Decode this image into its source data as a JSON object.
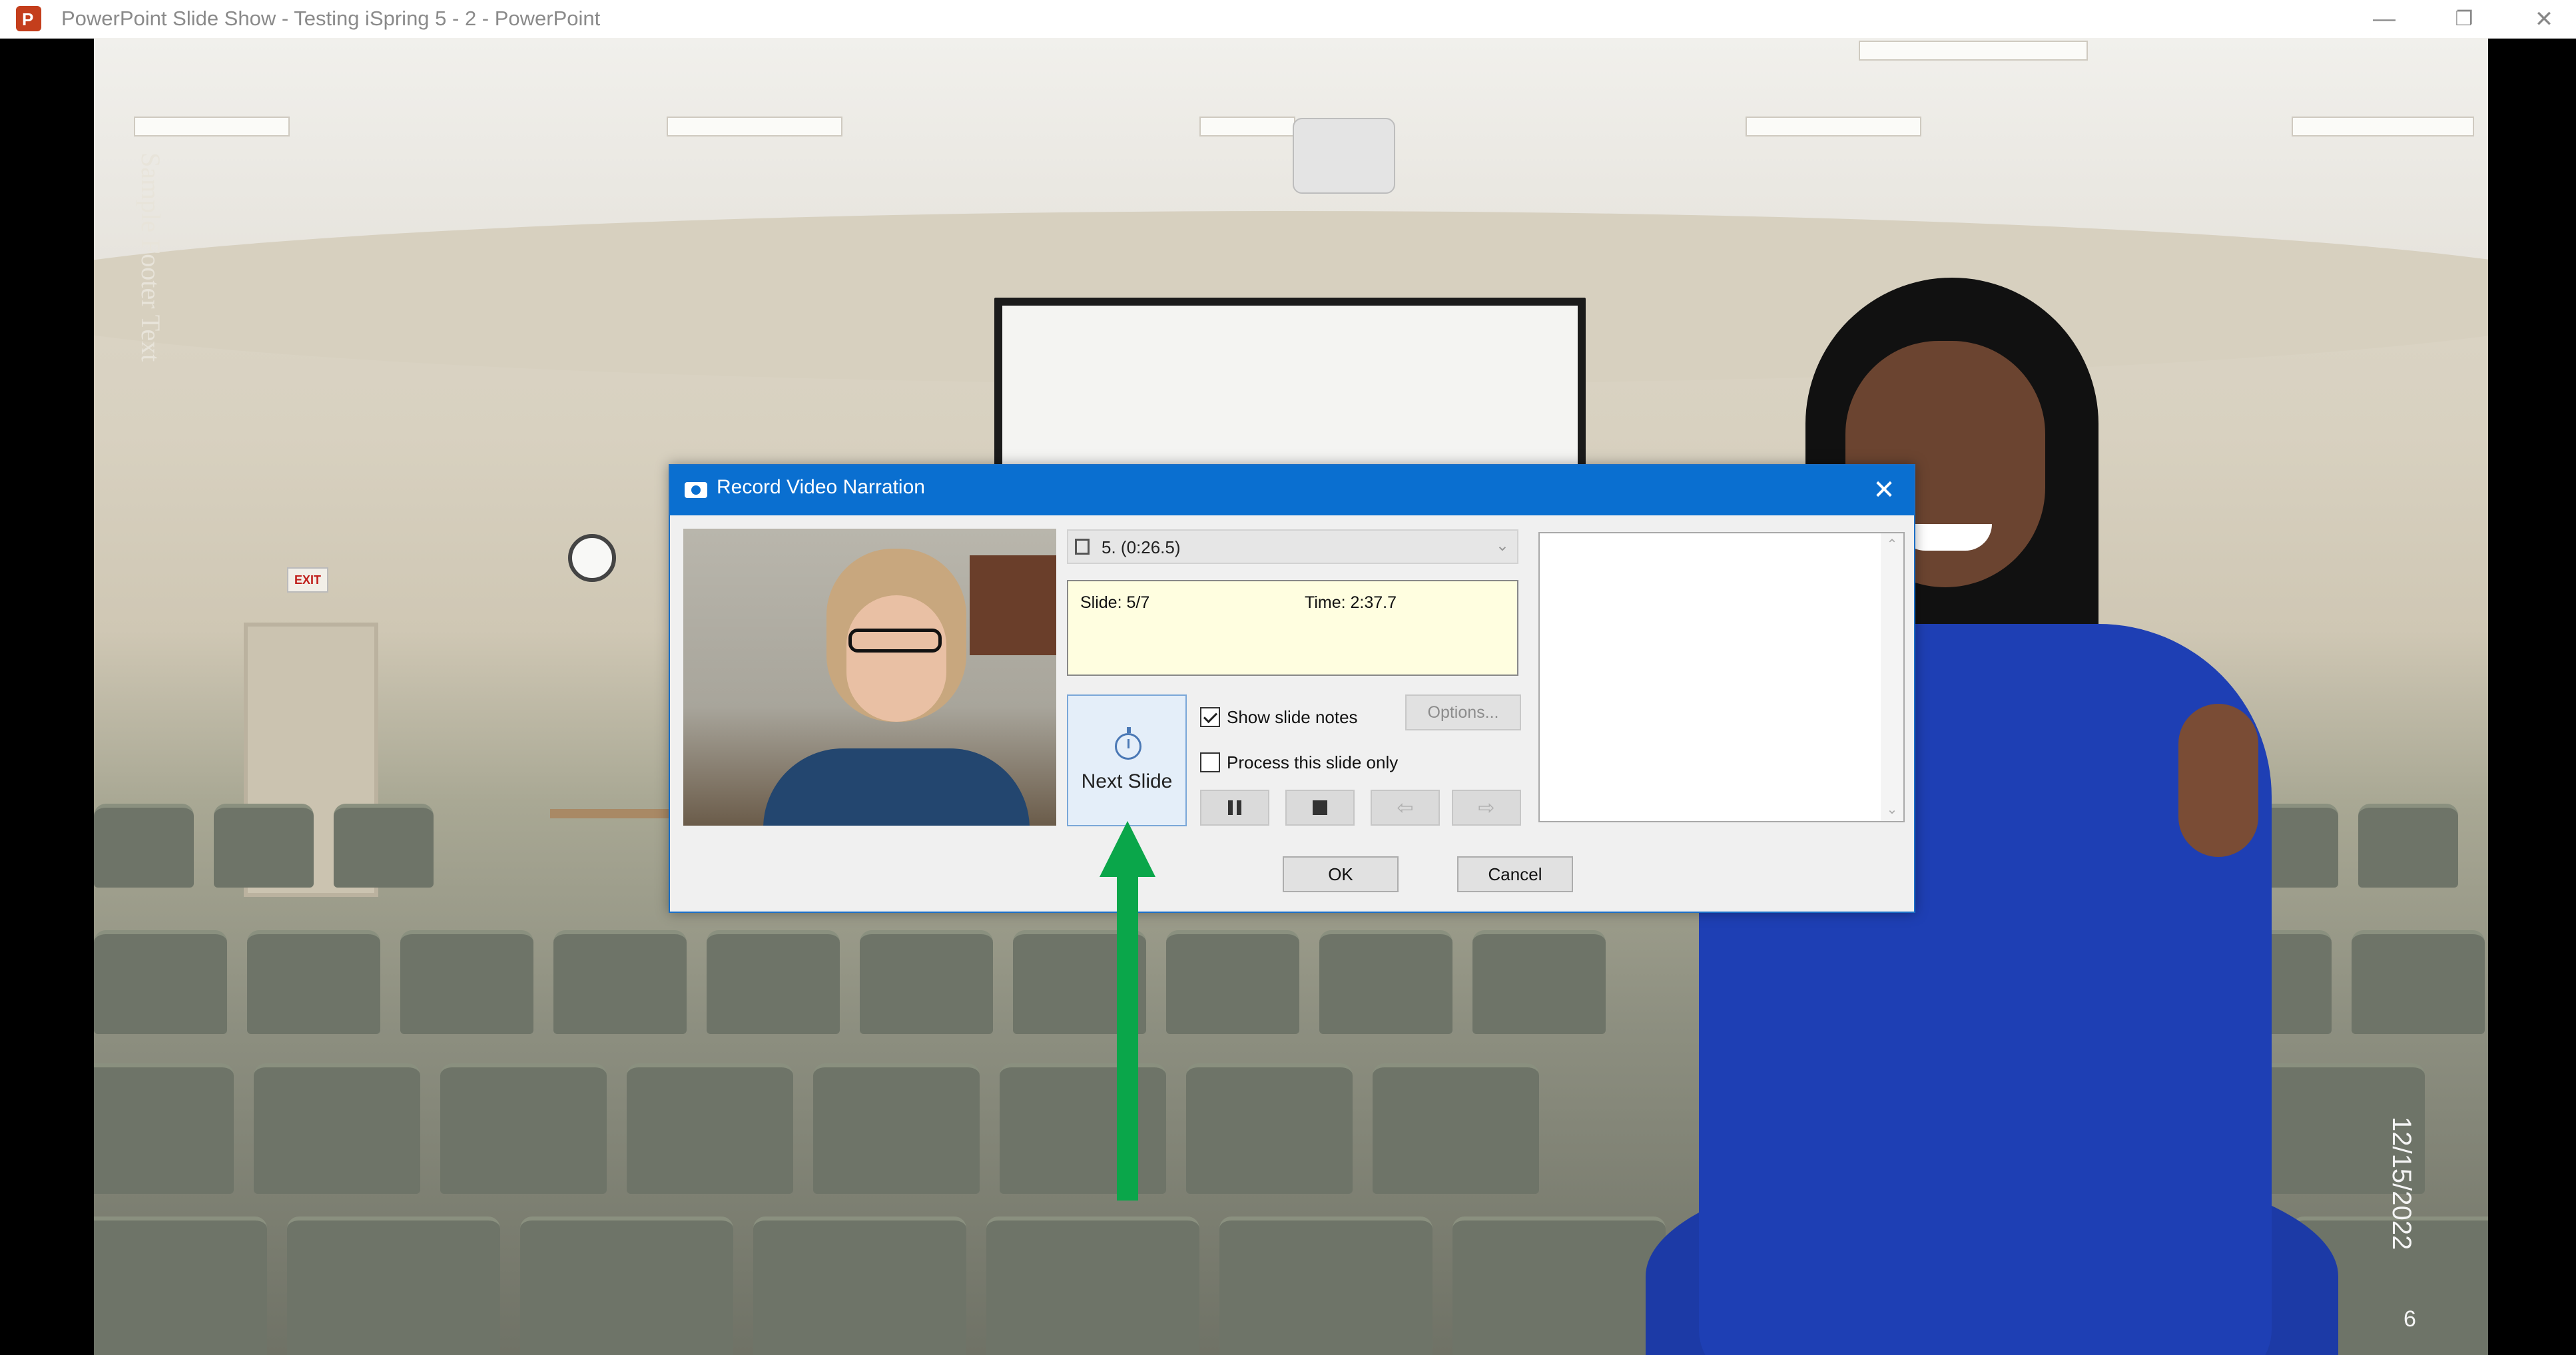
{
  "window": {
    "title": "PowerPoint Slide Show  -  Testing iSpring 5  -  2  -  PowerPoint",
    "app_icon": "powerpoint-icon",
    "app_icon_letter": "P",
    "minimize": "—",
    "restore": "❐",
    "close": "✕"
  },
  "slide": {
    "footer_text": "Sample Footer Text",
    "date": "12/15/2022",
    "number": "6",
    "exit_sign": "EXIT"
  },
  "dialog": {
    "title": "Record Video Narration",
    "close": "✕",
    "slide_selector": {
      "value": "5. (0:26.5)",
      "arrow": "⌄"
    },
    "info": {
      "slide": "Slide: 5/7",
      "time": "Time: 2:37.7"
    },
    "next_slide_label": "Next Slide",
    "show_slide_notes": {
      "label": "Show slide notes",
      "checked": true
    },
    "process_this_slide_only": {
      "label": "Process this slide only",
      "checked": false
    },
    "options_label": "Options...",
    "controls": {
      "back_arrow": "⇦",
      "forward_arrow": "⇨"
    },
    "notes_scroll": {
      "up": "⌃",
      "down": "⌄"
    },
    "ok_label": "OK",
    "cancel_label": "Cancel"
  },
  "colors": {
    "dialog_title_bar": "#0a6fd0",
    "annotation_arrow": "#0aa64a",
    "info_background": "#fffee0"
  }
}
